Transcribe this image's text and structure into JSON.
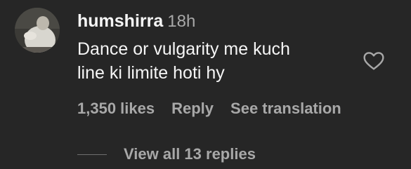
{
  "comment": {
    "username": "humshirra",
    "timestamp": "18h",
    "text_lines": [
      "Dance or vulgarity me kuch",
      "line ki limite hoti hy"
    ],
    "likes_label": "1,350 likes",
    "reply_label": "Reply",
    "translate_label": "See translation",
    "view_replies_label": "View all 13 replies",
    "avatar_icon": "profile-photo",
    "like_icon": "heart-outline-icon"
  },
  "colors": {
    "background": "#262626",
    "primary_text": "#f5f5f5",
    "secondary_text": "#a8a8a8"
  }
}
